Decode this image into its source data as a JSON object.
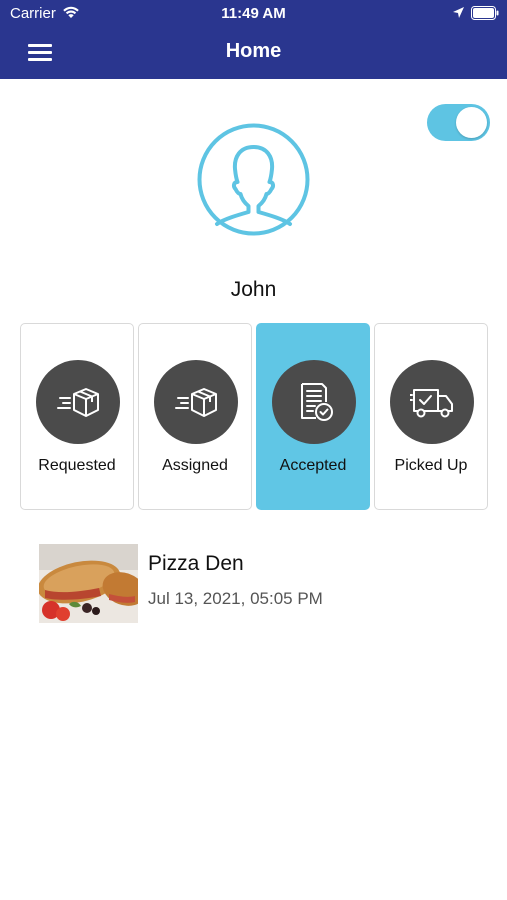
{
  "status_bar": {
    "carrier": "Carrier",
    "time": "11:49 AM",
    "icons": [
      "wifi-icon",
      "location-icon",
      "battery-icon"
    ]
  },
  "header": {
    "title": "Home",
    "menu_icon": "hamburger-menu-icon",
    "background": "#2a368f"
  },
  "toggle": {
    "state": "on",
    "color": "#5ec4e3"
  },
  "profile": {
    "avatar_icon": "user-avatar-icon",
    "name": "John",
    "accent": "#5ec4e3"
  },
  "status_tabs": [
    {
      "label": "Requested",
      "icon": "package-fast-icon",
      "active": false
    },
    {
      "label": "Assigned",
      "icon": "package-fast-icon",
      "active": false
    },
    {
      "label": "Accepted",
      "icon": "checklist-icon",
      "active": true
    },
    {
      "label": "Picked Up",
      "icon": "delivery-truck-icon",
      "active": false
    }
  ],
  "active_tab_color": "#60c6e5",
  "orders": [
    {
      "name": "Pizza Den",
      "date": "Jul 13, 2021, 05:05 PM",
      "image": "food-thumbnail"
    }
  ]
}
